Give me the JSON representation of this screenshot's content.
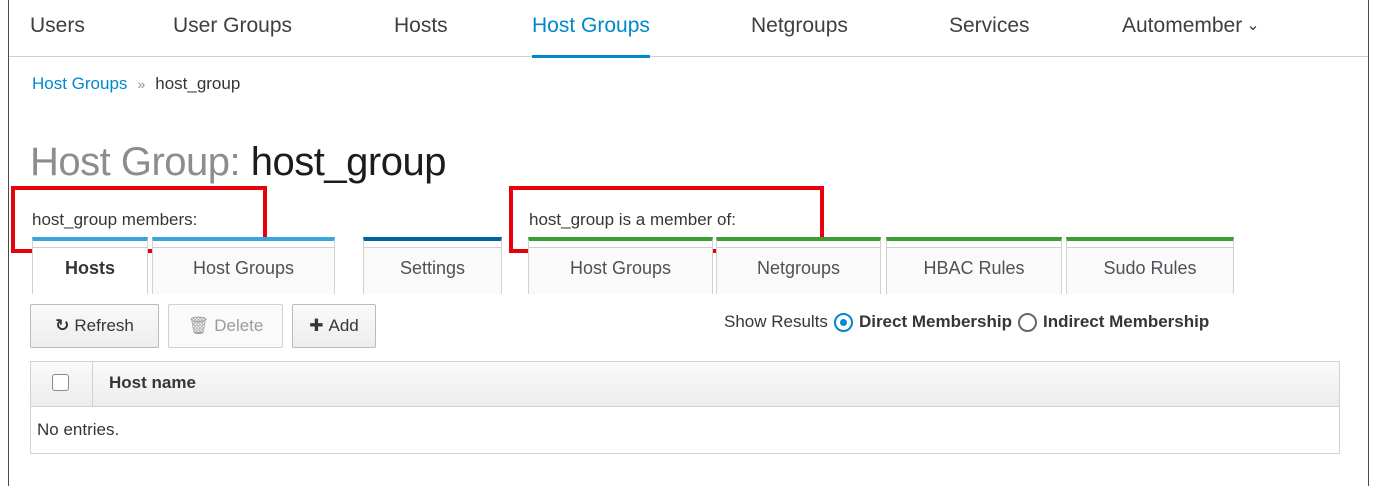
{
  "topnav": {
    "items": [
      {
        "label": "Users",
        "active": false
      },
      {
        "label": "User Groups",
        "active": false
      },
      {
        "label": "Hosts",
        "active": false
      },
      {
        "label": "Host Groups",
        "active": true
      },
      {
        "label": "Netgroups",
        "active": false
      },
      {
        "label": "Services",
        "active": false
      },
      {
        "label": "Automember",
        "active": false,
        "has_dropdown": true
      }
    ]
  },
  "breadcrumb": {
    "parent": "Host Groups",
    "separator": "»",
    "current": "host_group"
  },
  "title": {
    "prefix": "Host Group:",
    "name": "host_group"
  },
  "sections": {
    "members_label": "host_group members:",
    "member_of_label": "host_group is a member of:"
  },
  "tabs": {
    "members": [
      {
        "label": "Hosts",
        "active": true
      },
      {
        "label": "Host Groups",
        "active": false
      }
    ],
    "settings": {
      "label": "Settings"
    },
    "member_of": [
      {
        "label": "Host Groups"
      },
      {
        "label": "Netgroups"
      },
      {
        "label": "HBAC Rules"
      },
      {
        "label": "Sudo Rules"
      }
    ]
  },
  "toolbar": {
    "refresh_label": "Refresh",
    "delete_label": "Delete",
    "add_label": "Add",
    "delete_enabled": false
  },
  "show_results": {
    "label": "Show Results",
    "options": [
      {
        "label": "Direct Membership",
        "checked": true
      },
      {
        "label": "Indirect Membership",
        "checked": false
      }
    ]
  },
  "table": {
    "columns": [
      "Host name"
    ],
    "rows": [],
    "empty_text": "No entries."
  },
  "colors": {
    "accent": "#0088ce",
    "highlight": "#e8000b",
    "tab_blue": "#39a5dc",
    "tab_darkblue": "#00659c",
    "tab_green": "#3f9c35"
  },
  "icons": {
    "refresh": "refresh-icon",
    "delete": "trash-icon",
    "add": "plus-icon",
    "automember_dropdown": "chevron-down-icon"
  }
}
